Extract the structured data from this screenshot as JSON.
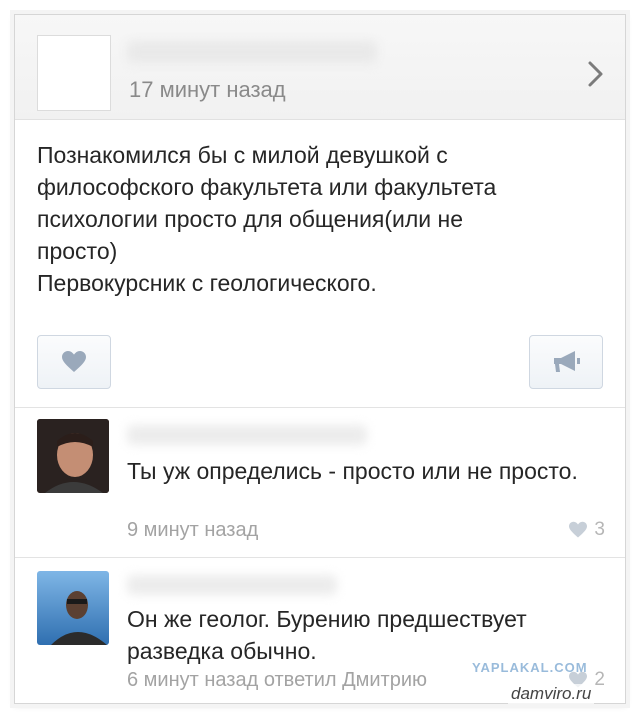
{
  "post": {
    "time": "17 минут назад",
    "text": "Познакомился бы с милой девушкой с\nфилософского факультета или факультета\nпсихологии просто для общения(или не\nпросто)\nПервокурсник с геологического."
  },
  "comments": [
    {
      "text": "Ты уж определись - просто или не просто.",
      "meta": "9 минут назад",
      "likes": "3"
    },
    {
      "text": "Он же геолог. Бурению предшествует разведка обычно.",
      "meta": "6 минут назад ответил Дмитрию",
      "likes": "2"
    }
  ],
  "watermarks": {
    "top": "YAPLAKAL.COM",
    "bottom": "damviro.ru"
  },
  "colors": {
    "muted_text": "#8a8a8a",
    "button_border": "#cfd7e1",
    "icon_blue_gray": "#9aa9bb"
  }
}
